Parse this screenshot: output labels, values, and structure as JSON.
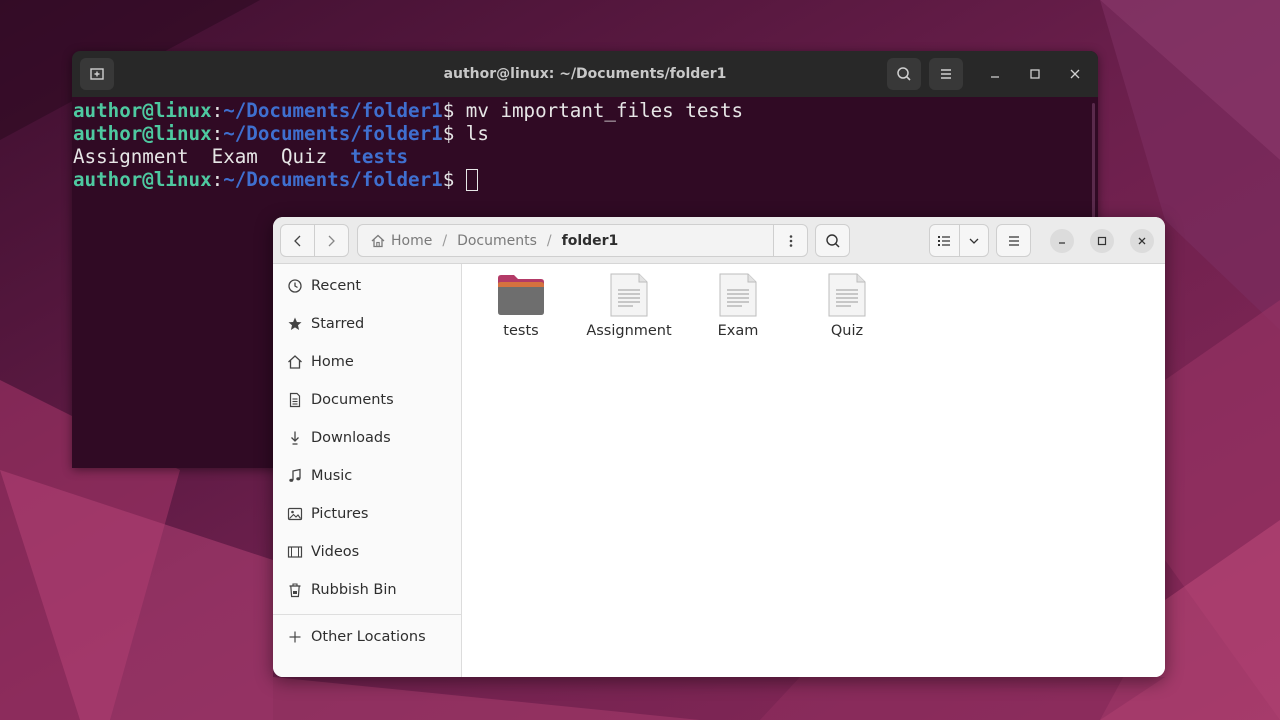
{
  "colors": {
    "terminal_bg": "#300a24",
    "terminal_user": "#4ec9a0",
    "terminal_path": "#3f6fcf",
    "folder_accent": "#b33a67"
  },
  "terminal": {
    "title": "author@linux: ~/Documents/folder1",
    "prompt_user": "author@linux",
    "prompt_colon": ":",
    "prompt_path": "~/Documents/folder1",
    "prompt_symbol": "$ ",
    "lines": [
      {
        "command": "mv important_files tests"
      },
      {
        "command": "ls"
      }
    ],
    "ls_output": {
      "files": [
        "Assignment",
        "Exam",
        "Quiz"
      ],
      "directories": [
        "tests"
      ]
    }
  },
  "files_window": {
    "breadcrumb": {
      "home": "Home",
      "separator": "/",
      "middle": "Documents",
      "current": "folder1"
    },
    "sidebar": {
      "items": [
        {
          "label": "Recent",
          "icon": "clock-icon"
        },
        {
          "label": "Starred",
          "icon": "star-icon"
        },
        {
          "label": "Home",
          "icon": "home-icon"
        },
        {
          "label": "Documents",
          "icon": "document-icon"
        },
        {
          "label": "Downloads",
          "icon": "download-icon"
        },
        {
          "label": "Music",
          "icon": "music-icon"
        },
        {
          "label": "Pictures",
          "icon": "picture-icon"
        },
        {
          "label": "Videos",
          "icon": "video-icon"
        },
        {
          "label": "Rubbish Bin",
          "icon": "trash-icon"
        }
      ],
      "other_locations": "Other Locations"
    },
    "items": [
      {
        "name": "tests",
        "type": "folder"
      },
      {
        "name": "Assignment",
        "type": "file"
      },
      {
        "name": "Exam",
        "type": "file"
      },
      {
        "name": "Quiz",
        "type": "file"
      }
    ]
  }
}
